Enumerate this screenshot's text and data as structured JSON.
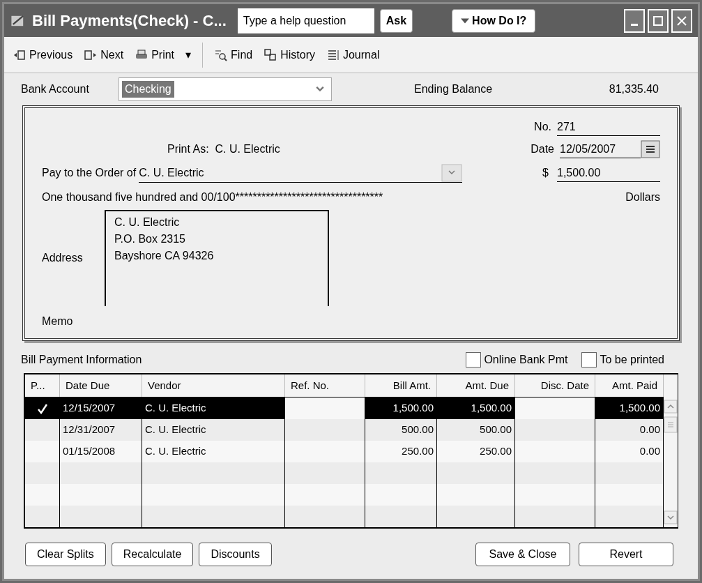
{
  "window": {
    "title": "Bill Payments(Check) - C...",
    "help_placeholder": "Type a help question",
    "ask": "Ask",
    "how_do_i": "How Do I?"
  },
  "toolbar": [
    {
      "label": "Previous"
    },
    {
      "label": "Next"
    },
    {
      "label": "Print"
    },
    {
      "label": "▾"
    },
    {
      "label": "Find"
    },
    {
      "label": "History"
    },
    {
      "label": "Journal"
    }
  ],
  "bank": {
    "label": "Bank Account",
    "value": "Checking",
    "balance_label": "Ending Balance",
    "balance": "81,335.40"
  },
  "check": {
    "no_label": "No.",
    "no": "271",
    "date_label": "Date",
    "date": "12/05/2007",
    "amount_label": "$",
    "amount": "1,500.00",
    "print_as": "Print As:  C. U. Electric",
    "pay_label": "Pay to the Order of",
    "payee": "C. U. Electric",
    "words": "One thousand five hundred and 00/100**********************************",
    "dollars": "Dollars",
    "address_label": "Address",
    "address": [
      "C. U. Electric",
      "P.O. Box 2315",
      "Bayshore CA 94326"
    ],
    "memo_label": "Memo"
  },
  "info": {
    "title": "Bill Payment Information",
    "options": [
      {
        "label": "Online Bank Pmt",
        "checked": false
      },
      {
        "label": "To be printed",
        "checked": false
      }
    ]
  },
  "table": {
    "columns": [
      "P...",
      "Date Due",
      "Vendor",
      "Ref. No.",
      "Bill Amt.",
      "Amt. Due",
      "Disc. Date",
      "Amt. Paid"
    ],
    "rows": [
      {
        "pay": true,
        "selected": true,
        "date": "12/15/2007",
        "vendor": "C. U. Electric",
        "bill": "1,500.00",
        "due": "1,500.00",
        "paid": "1,500.00"
      },
      {
        "pay": false,
        "selected": false,
        "date": "12/31/2007",
        "vendor": "C. U. Electric",
        "bill": "500.00",
        "due": "500.00",
        "paid": "0.00"
      },
      {
        "pay": false,
        "selected": false,
        "date": "01/15/2008",
        "vendor": "C. U. Electric",
        "bill": "250.00",
        "due": "250.00",
        "paid": "0.00"
      }
    ]
  },
  "buttons_left": [
    "Clear Splits",
    "Recalculate",
    "Discounts"
  ],
  "buttons_right": [
    "Save & Close",
    "Revert"
  ]
}
